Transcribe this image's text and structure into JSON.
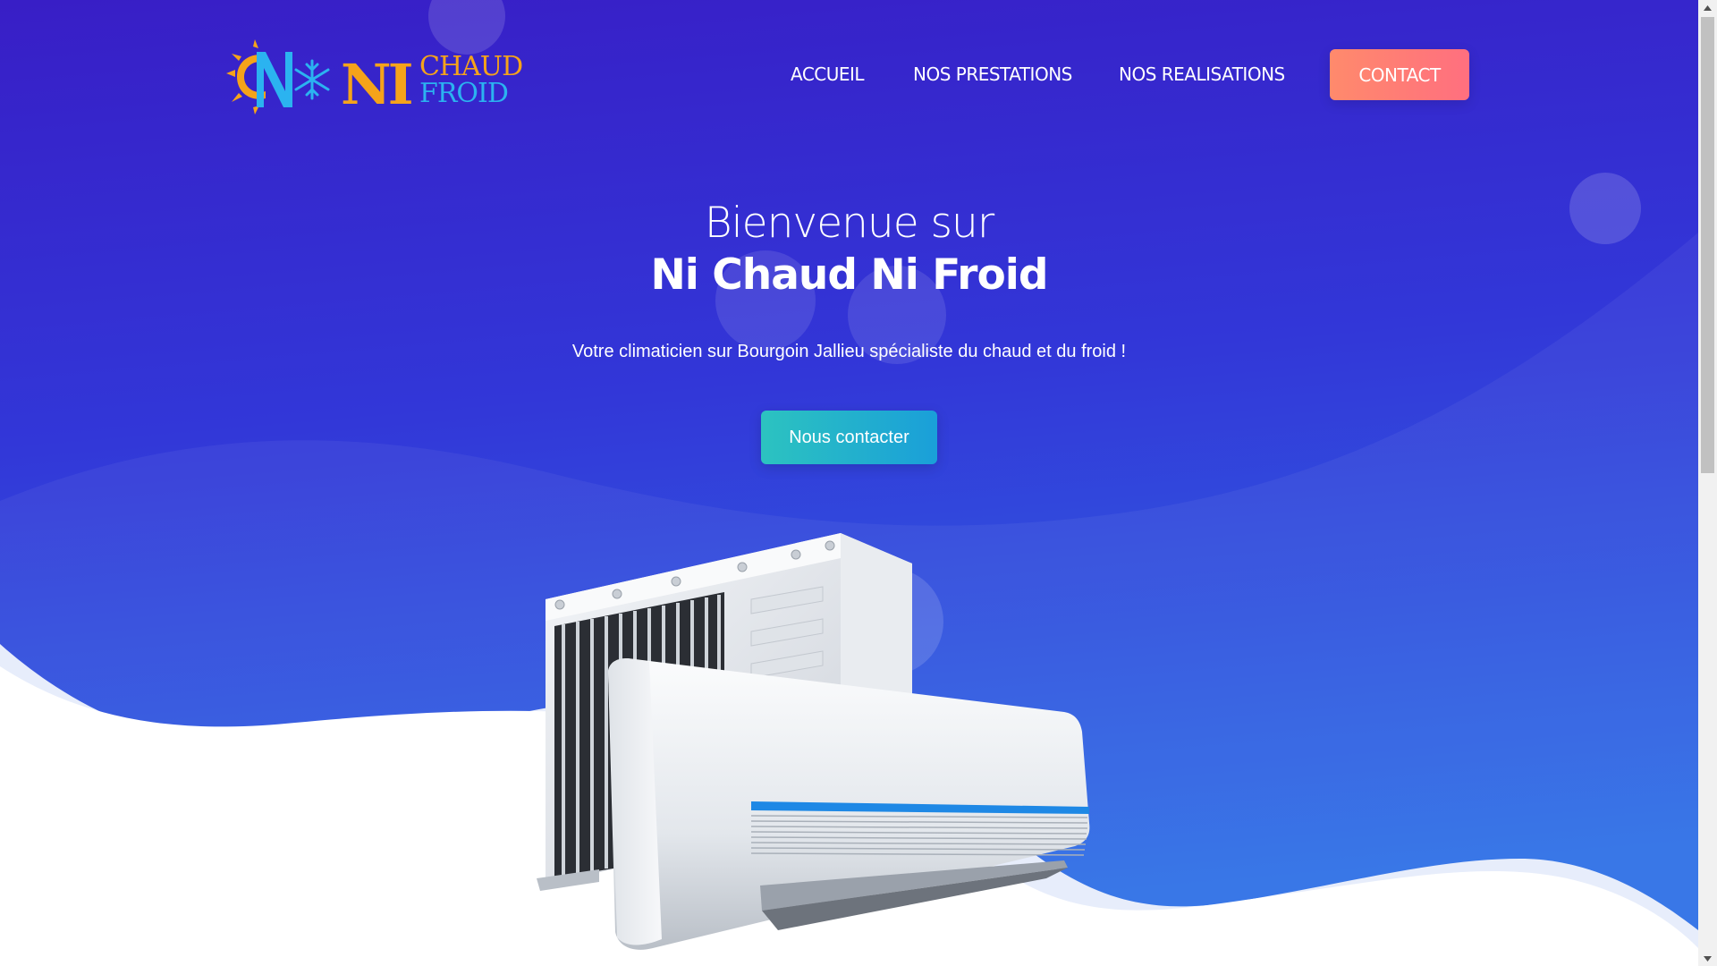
{
  "logo": {
    "text_ni": "NI",
    "text_chaud": "CHAUD",
    "text_froid": "FROID"
  },
  "nav": {
    "items": [
      {
        "label": "ACCUEIL"
      },
      {
        "label": "NOS PRESTATIONS"
      },
      {
        "label": "NOS REALISATIONS"
      }
    ],
    "contact_label": "CONTACT"
  },
  "hero": {
    "title_line1": "Bienvenue sur",
    "title_line2": "Ni Chaud Ni Froid",
    "subtitle": "Votre climaticien sur Bourgoin Jallieu spécialiste du chaud et du froid !",
    "cta_label": "Nous contacter"
  },
  "colors": {
    "hero_top": "#3a1fc8",
    "hero_bottom": "#2f6ee8",
    "logo_orange": "#f5a31a",
    "logo_blue": "#2bb3f0",
    "contact_button": "#ff7a75",
    "cta_button": "#22b3c9"
  },
  "icons": {
    "scroll_up": "triangle-up-icon",
    "scroll_down": "triangle-down-icon"
  }
}
